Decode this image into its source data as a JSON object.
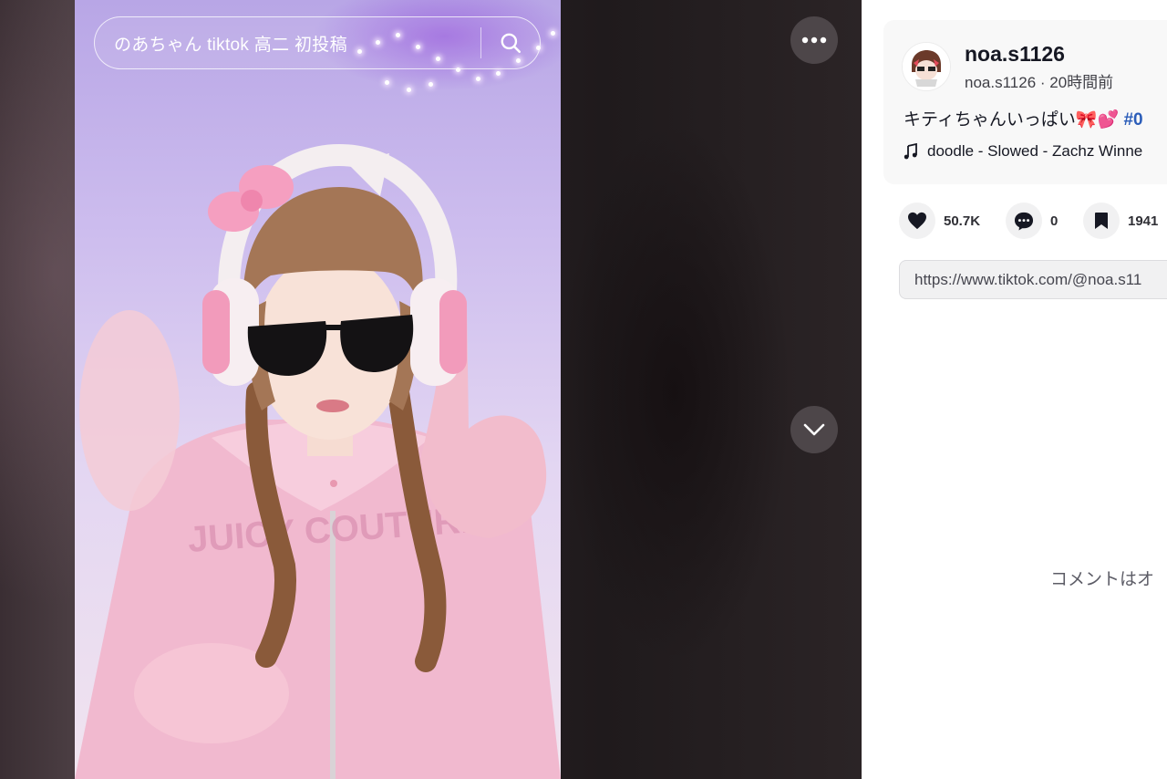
{
  "search": {
    "query": "のあちゃん tiktok 高二 初投稿",
    "button_icon": "search-icon"
  },
  "video": {
    "more_icon": "more-horizontal-icon",
    "next_icon": "chevron-down-icon"
  },
  "post": {
    "username": "noa.s1126",
    "meta": "noa.s1126 · 20時間前",
    "caption_text": "キティちゃんいっぱい🎀💕",
    "caption_hashtag": "#0",
    "music": "doodle - Slowed - Zachz Winne"
  },
  "actions": {
    "likes": "50.7K",
    "comments": "0",
    "saves": "1941"
  },
  "share": {
    "link": "https://www.tiktok.com/@noa.s11"
  },
  "comments_message": "コメントはオ"
}
